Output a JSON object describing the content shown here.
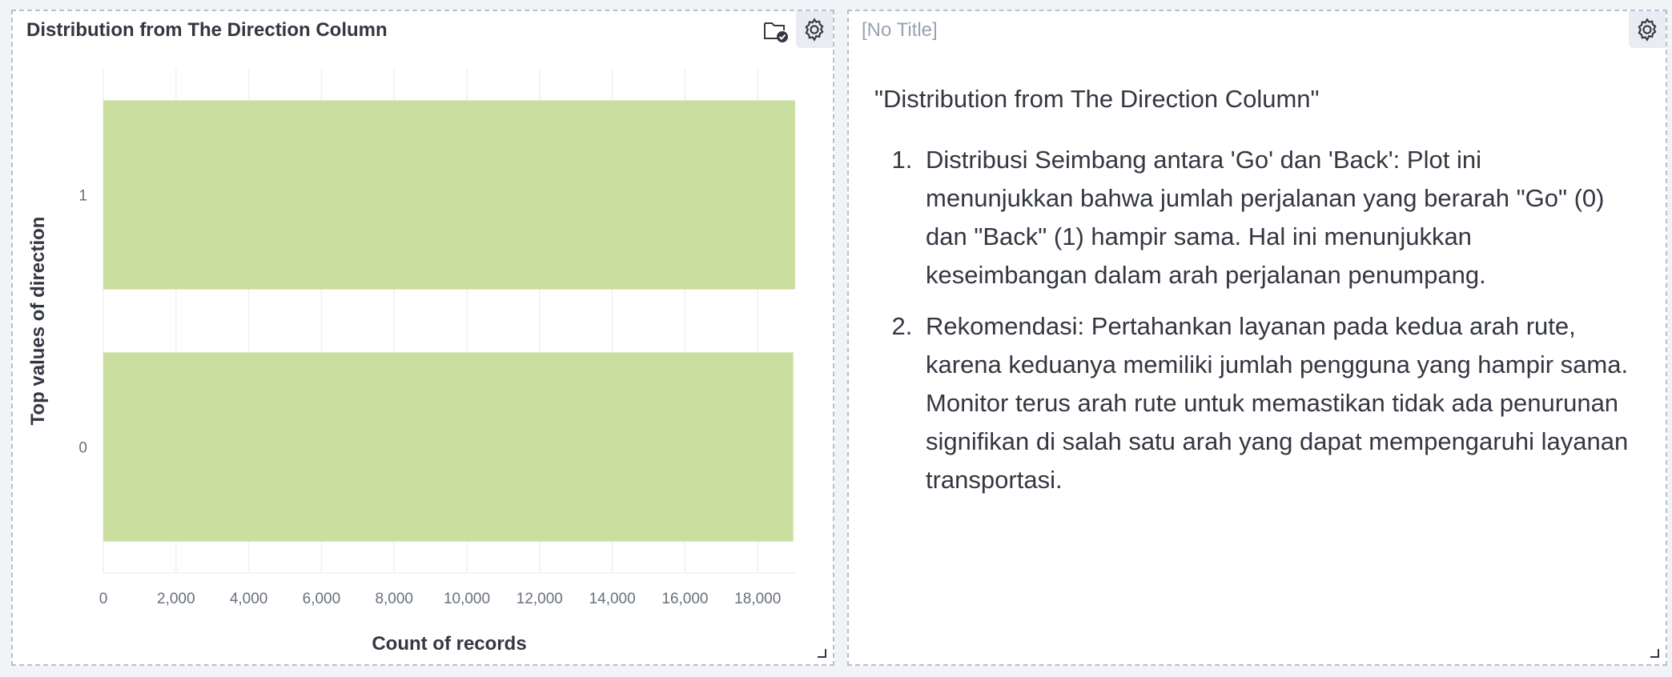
{
  "left_panel": {
    "title": "Distribution from The Direction Column",
    "icons": [
      "folder-check-icon",
      "gear-icon",
      "resize-handle-icon"
    ]
  },
  "right_panel": {
    "title": "[No Title]",
    "heading": "\"Distribution from The Direction Column\"",
    "items": [
      "Distribusi Seimbang antara 'Go' dan 'Back': Plot ini menunjukkan bahwa jumlah perjalanan yang berarah \"Go\" (0) dan \"Back\" (1) hampir sama. Hal ini menunjukkan keseimbangan dalam arah perjalanan penumpang.",
      "Rekomendasi: Pertahankan layanan pada kedua arah rute, karena keduanya memiliki jumlah pengguna yang hampir sama. Monitor terus arah rute untuk memastikan tidak ada penurunan signifikan di salah satu arah yang dapat mempengaruhi layanan transportasi."
    ],
    "icons": [
      "gear-icon",
      "resize-handle-icon"
    ]
  },
  "colors": {
    "bar": "#cadf9f",
    "gear_bg": "#e9edf3",
    "panel_border": "#b8bfcc"
  },
  "chart_data": {
    "type": "bar",
    "orientation": "horizontal",
    "categories": [
      "1",
      "0"
    ],
    "values": [
      19030,
      18980
    ],
    "xlabel": "Count of records",
    "ylabel": "Top values of direction",
    "xticks": [
      0,
      2000,
      4000,
      6000,
      8000,
      10000,
      12000,
      14000,
      16000,
      18000
    ],
    "xtick_labels": [
      "0",
      "2,000",
      "4,000",
      "6,000",
      "8,000",
      "10,000",
      "12,000",
      "14,000",
      "16,000",
      "18,000"
    ],
    "xlim": [
      0,
      19030
    ],
    "grid": true,
    "legend": "none"
  }
}
